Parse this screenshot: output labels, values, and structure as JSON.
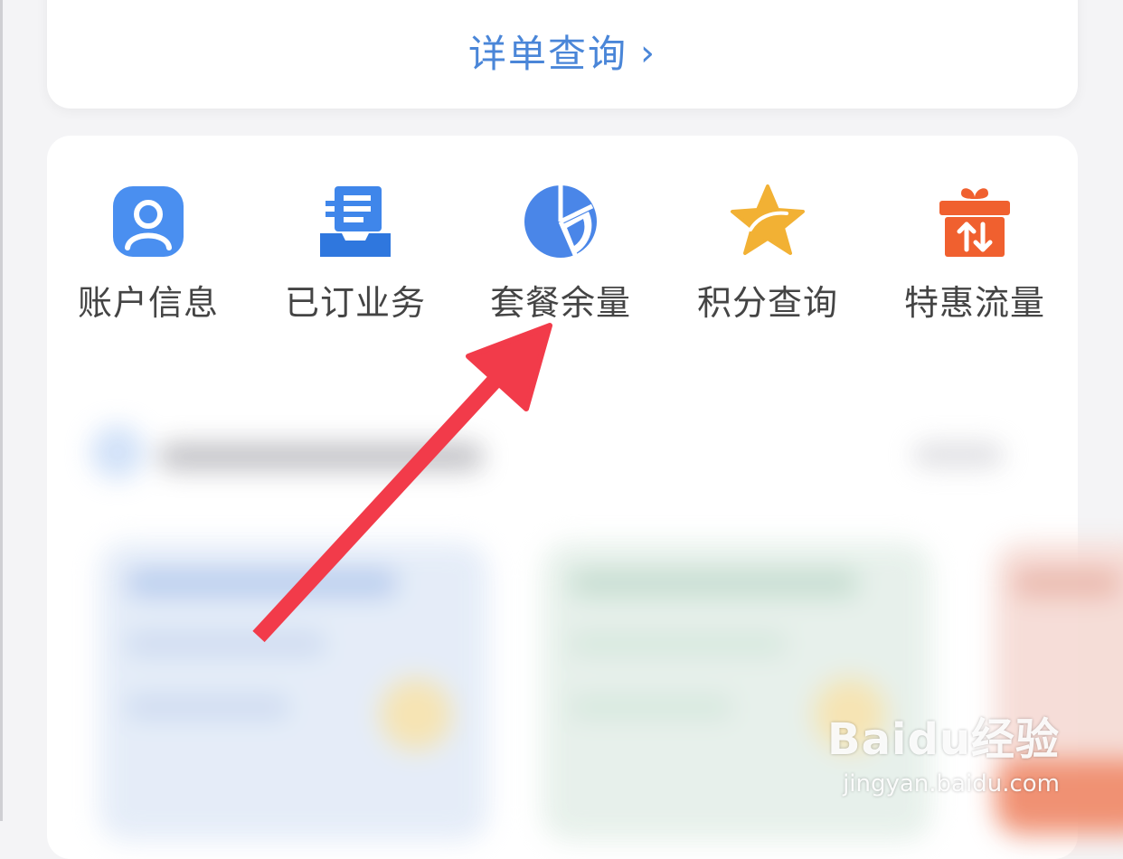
{
  "detail_card": {
    "link_label": "详单查询",
    "chevron": "›"
  },
  "quick_menu": {
    "items": [
      {
        "label": "账户信息",
        "icon": "account-icon",
        "color": "#4a8ff0"
      },
      {
        "label": "已订业务",
        "icon": "subscribed-services-icon",
        "color": "#3f86ea"
      },
      {
        "label": "套餐余量",
        "icon": "plan-balance-icon",
        "color": "#4a86e8"
      },
      {
        "label": "积分查询",
        "icon": "star-icon",
        "color": "#f2b134"
      },
      {
        "label": "特惠流量",
        "icon": "gift-icon",
        "color": "#f0602f"
      }
    ]
  },
  "annotation": {
    "arrow_color": "#f23b4a"
  },
  "watermark": {
    "logo_text": "Baidu经验",
    "url": "jingyan.baidu.com"
  }
}
